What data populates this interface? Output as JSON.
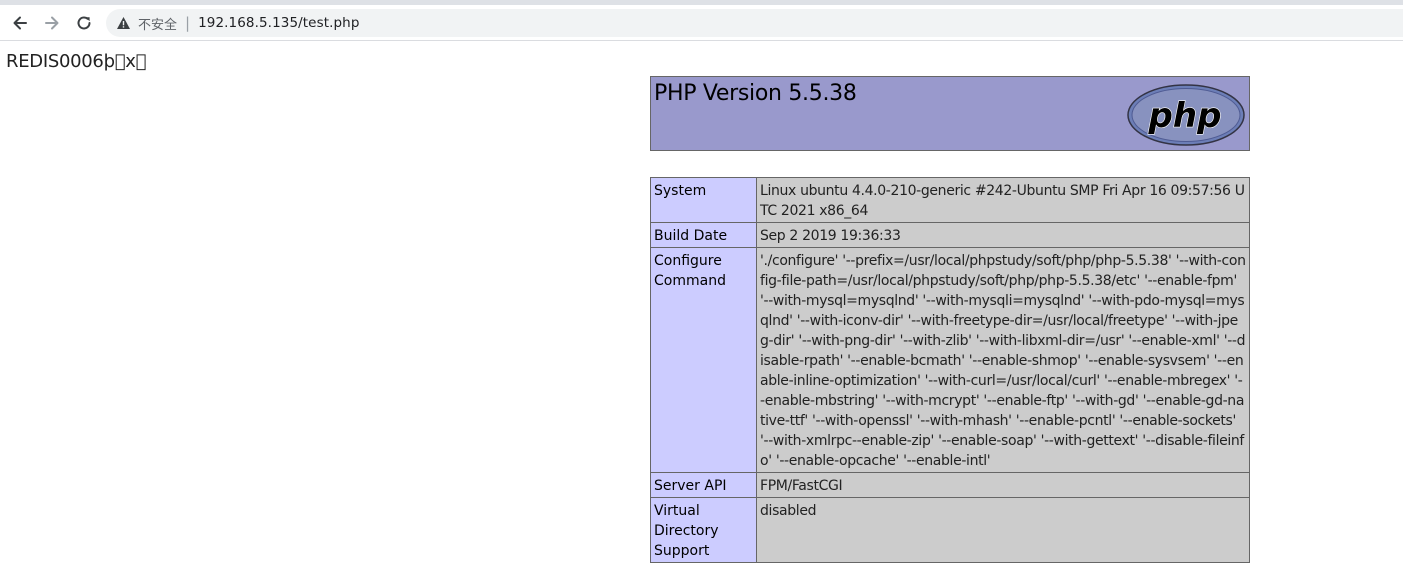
{
  "browser": {
    "security_label": "不安全",
    "separator": "|",
    "url": "192.168.5.135/test.php"
  },
  "page": {
    "redis_text": "REDIS0006þ\u0000x\u0000"
  },
  "phpinfo": {
    "title": "PHP Version 5.5.38",
    "logo_text": "php",
    "rows": [
      {
        "key": "System",
        "value": "Linux ubuntu 4.4.0-210-generic #242-Ubuntu SMP Fri Apr 16 09:57:56 UTC 2021 x86_64"
      },
      {
        "key": "Build Date",
        "value": "Sep 2 2019 19:36:33"
      },
      {
        "key": "Configure Command",
        "value": "'./configure' '--prefix=/usr/local/phpstudy/soft/php/php-5.5.38' '--with-config-file-path=/usr/local/phpstudy/soft/php/php-5.5.38/etc' '--enable-fpm' '--with-mysql=mysqlnd' '--with-mysqli=mysqlnd' '--with-pdo-mysql=mysqlnd' '--with-iconv-dir' '--with-freetype-dir=/usr/local/freetype' '--with-jpeg-dir' '--with-png-dir' '--with-zlib' '--with-libxml-dir=/usr' '--enable-xml' '--disable-rpath' '--enable-bcmath' '--enable-shmop' '--enable-sysvsem' '--enable-inline-optimization' '--with-curl=/usr/local/curl' '--enable-mbregex' '--enable-mbstring' '--with-mcrypt' '--enable-ftp' '--with-gd' '--enable-gd-native-ttf' '--with-openssl' '--with-mhash' '--enable-pcntl' '--enable-sockets' '--with-xmlrpc--enable-zip' '--enable-soap' '--with-gettext' '--disable-fileinfo' '--enable-opcache' '--enable-intl'"
      },
      {
        "key": "Server API",
        "value": "FPM/FastCGI"
      },
      {
        "key": "Virtual Directory Support",
        "value": "disabled"
      }
    ]
  },
  "colors": {
    "header_bg": "#9999cc",
    "key_bg": "#ccccff",
    "value_bg": "#cccccc"
  }
}
